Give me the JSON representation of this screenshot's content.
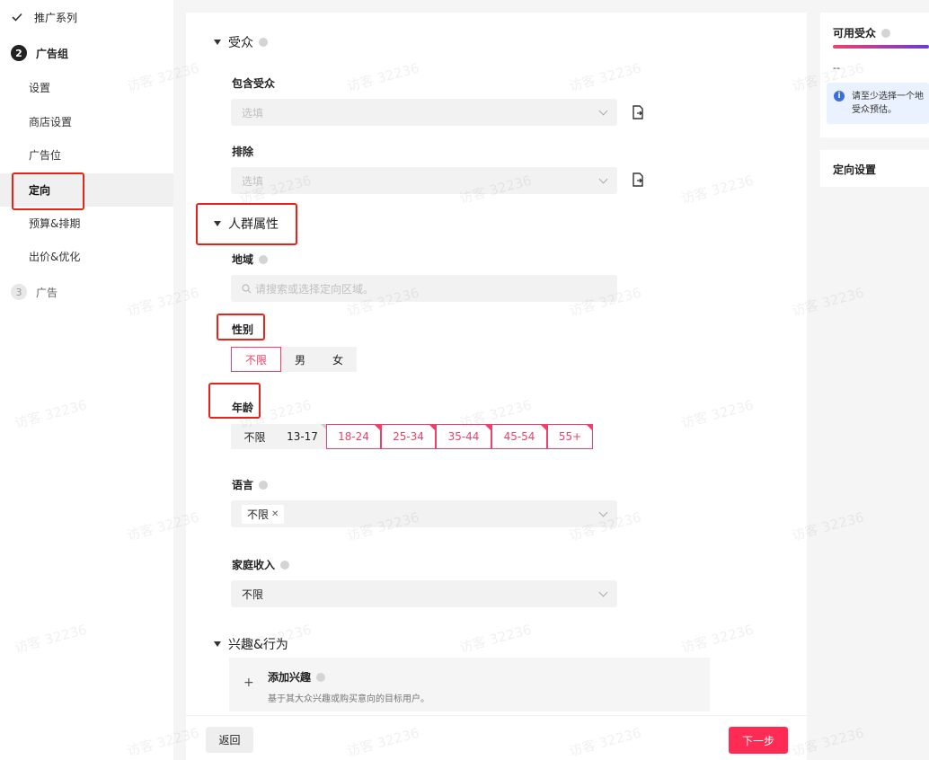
{
  "sidebar": {
    "step1": "推广系列",
    "step2_num": "2",
    "step2": "广告组",
    "sub_items": [
      "设置",
      "商店设置",
      "广告位",
      "定向",
      "预算&排期",
      "出价&优化"
    ],
    "step3_num": "3",
    "step3": "广告"
  },
  "main": {
    "audience": {
      "title": "受众",
      "include_label": "包含受众",
      "include_placeholder": "选填",
      "exclude_label": "排除",
      "exclude_placeholder": "选填"
    },
    "demographics": {
      "title": "人群属性",
      "region_label": "地域",
      "region_placeholder": "请搜索或选择定向区域。",
      "gender_label": "性别",
      "gender_options": [
        "不限",
        "男",
        "女"
      ],
      "age_label": "年龄",
      "age_options": [
        "不限",
        "13-17",
        "18-24",
        "25-34",
        "35-44",
        "45-54",
        "55+"
      ],
      "language_label": "语言",
      "language_tag": "不限",
      "income_label": "家庭收入",
      "income_value": "不限"
    },
    "interest": {
      "title": "兴趣&行为",
      "add_title": "添加兴趣",
      "add_desc": "基于其大众兴趣或购买意向的目标用户。",
      "plus": "+"
    }
  },
  "footer": {
    "back": "返回",
    "next": "下一步"
  },
  "right": {
    "available_title": "可用受众",
    "available_value": "--",
    "info_text_1": "请至少选择一个地",
    "info_text_2": "受众预估。",
    "targeting_title": "定向设置"
  },
  "watermark": "访客 32236",
  "colors": {
    "accent": "#fe2c55",
    "annotation": "#e8231a"
  }
}
